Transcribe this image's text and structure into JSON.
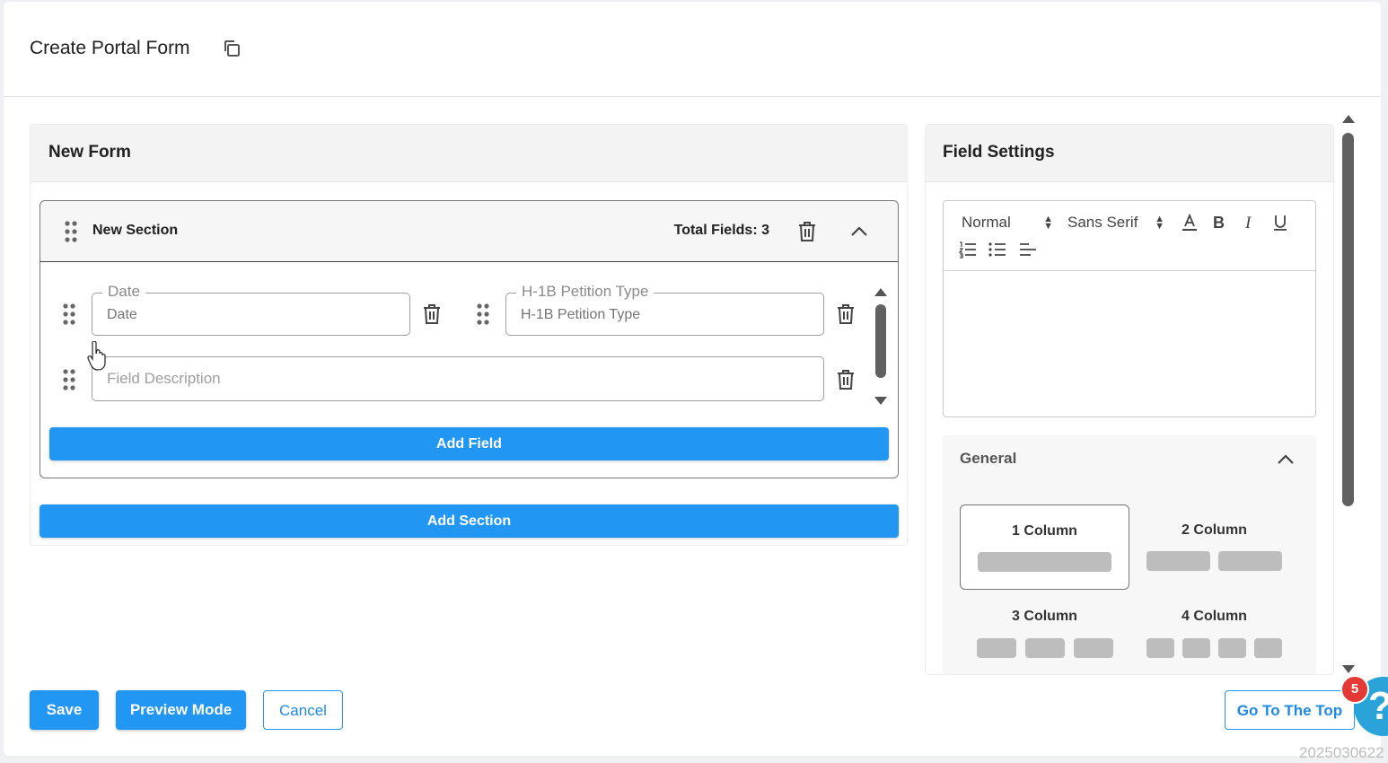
{
  "header": {
    "title": "Create Portal Form",
    "copy_icon": "copy-icon"
  },
  "form": {
    "title": "New Form",
    "section": {
      "name": "New Section",
      "total_fields_label": "Total Fields: 3",
      "fields": [
        {
          "legend": "Date",
          "value": "Date"
        },
        {
          "legend": "H-1B Petition Type",
          "value": "H-1B Petition Type"
        },
        {
          "placeholder": "Field Description"
        }
      ],
      "add_field_label": "Add Field"
    },
    "add_section_label": "Add Section"
  },
  "settings": {
    "title": "Field Settings",
    "toolbar": {
      "heading_select": "Normal",
      "font_select": "Sans Serif",
      "buttons": [
        "text-color-icon",
        "bold-icon",
        "italic-icon",
        "underline-icon",
        "ordered-list-icon",
        "bullet-list-icon",
        "align-icon"
      ]
    },
    "general": {
      "title": "General",
      "columns": [
        "1 Column",
        "2 Column",
        "3 Column",
        "4 Column"
      ],
      "selected": "1 Column"
    }
  },
  "footer": {
    "save_label": "Save",
    "preview_label": "Preview Mode",
    "cancel_label": "Cancel",
    "top_label": "Go To The Top",
    "help_badge": "5",
    "help_glyph": "?",
    "version": "2025030622"
  },
  "colors": {
    "primary": "#2196f3",
    "badge": "#e53935",
    "help": "#29a3d8"
  }
}
